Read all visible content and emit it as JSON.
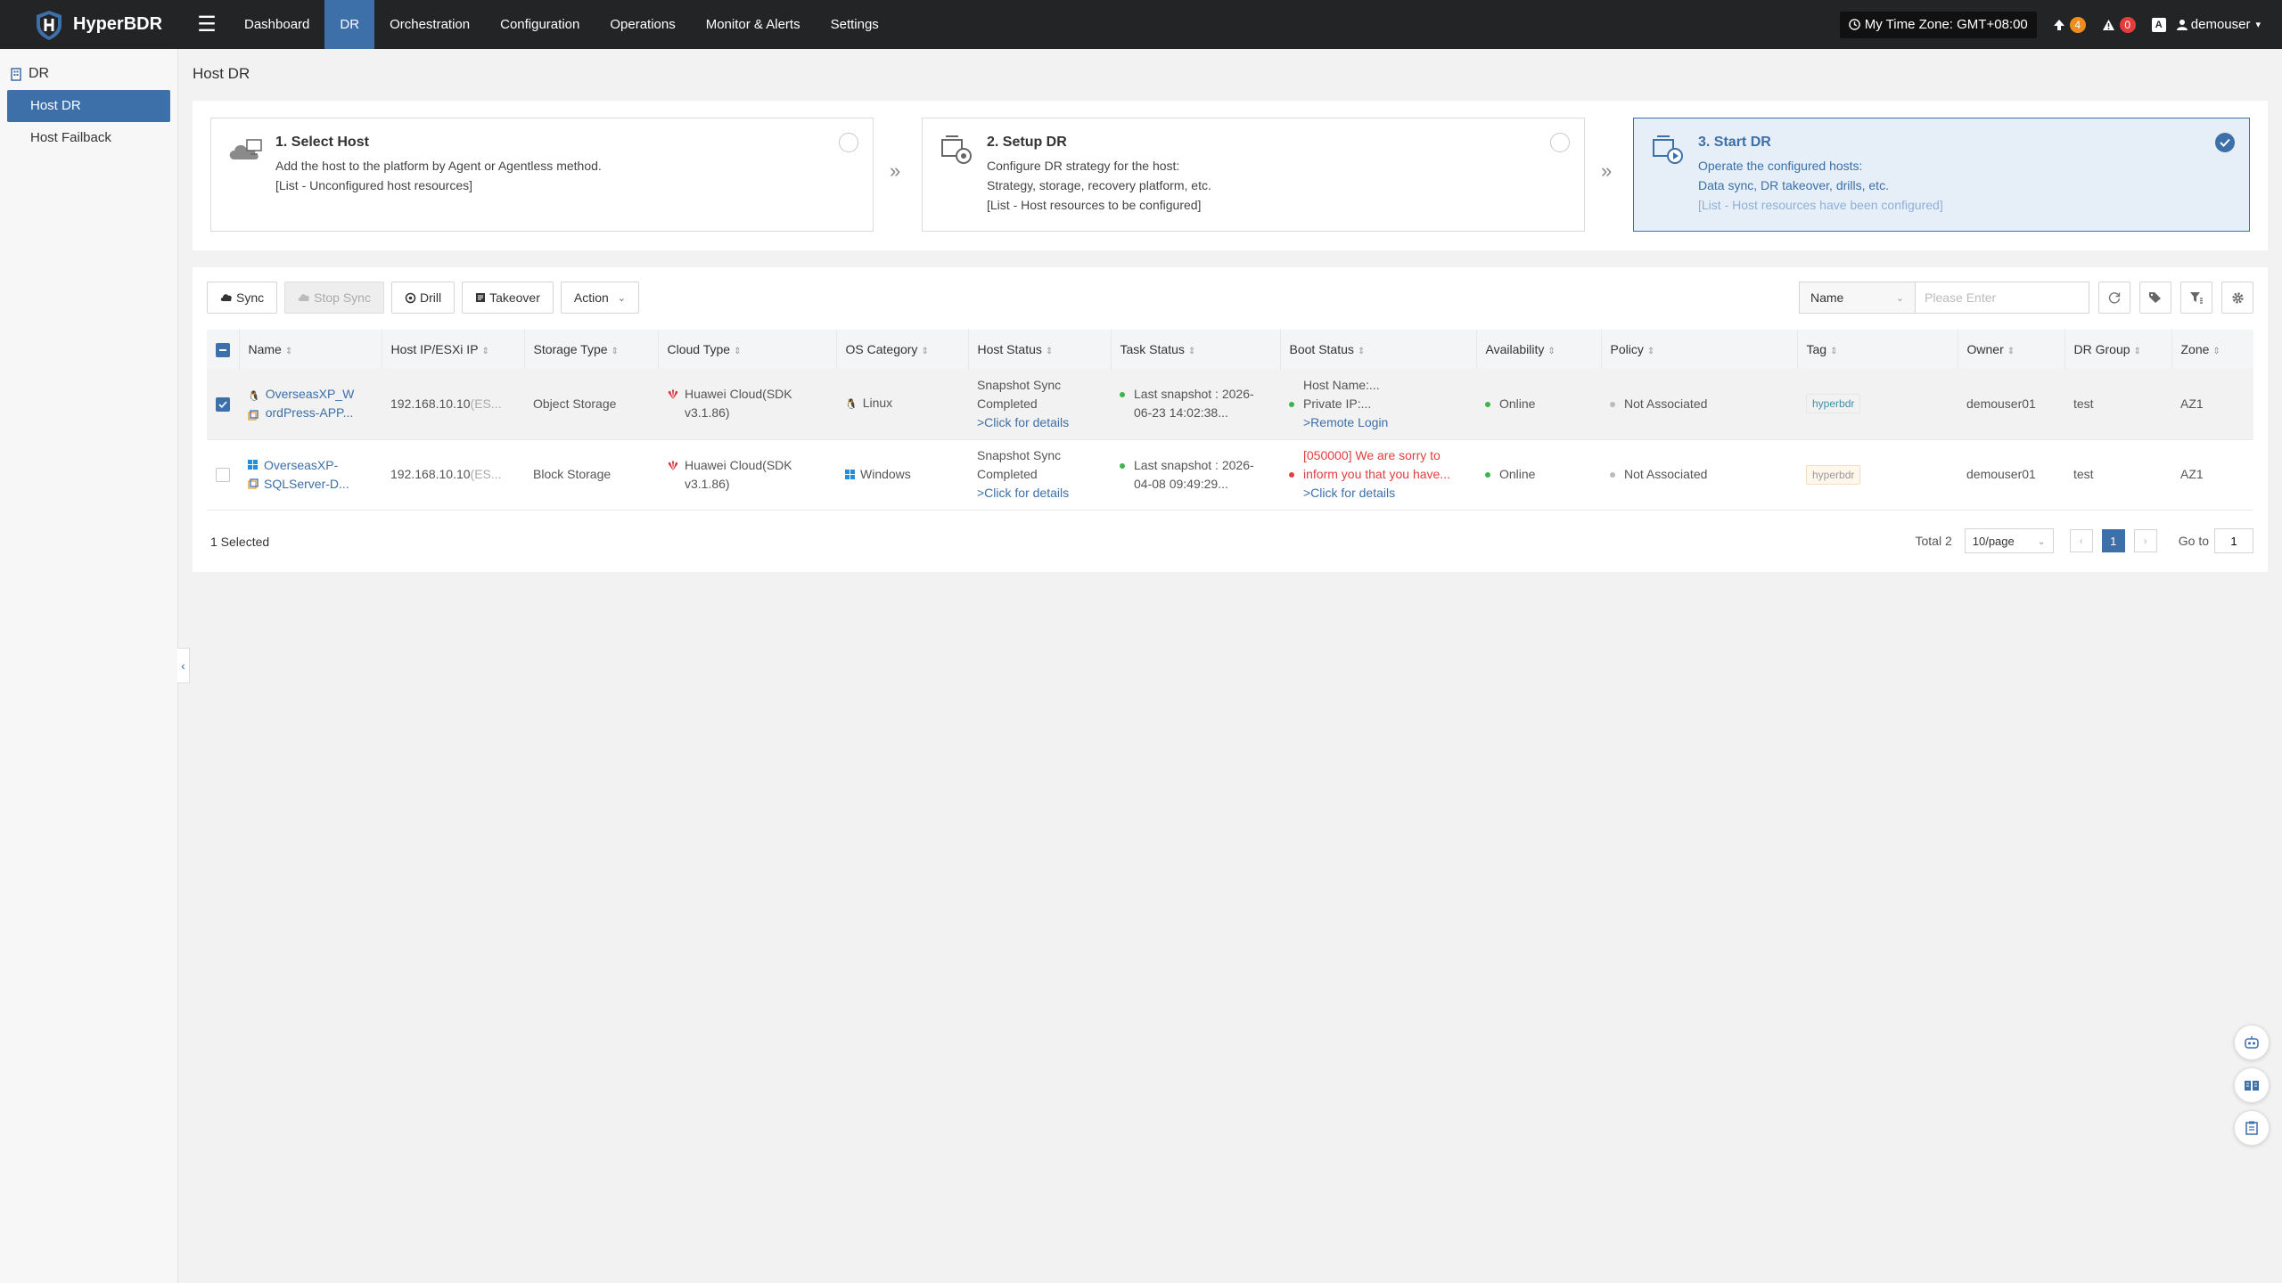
{
  "brand": {
    "name": "HyperBDR"
  },
  "nav": [
    {
      "label": "Dashboard",
      "active": false
    },
    {
      "label": "DR",
      "active": true
    },
    {
      "label": "Orchestration",
      "active": false
    },
    {
      "label": "Configuration",
      "active": false
    },
    {
      "label": "Operations",
      "active": false
    },
    {
      "label": "Monitor & Alerts",
      "active": false
    },
    {
      "label": "Settings",
      "active": false
    }
  ],
  "header_right": {
    "timezone": "My Time Zone: GMT+08:00",
    "upload_count": "4",
    "alert_count": "0",
    "user": "demouser"
  },
  "sidebar": {
    "group": "DR",
    "items": [
      {
        "label": "Host DR",
        "active": true
      },
      {
        "label": "Host Failback",
        "active": false
      }
    ]
  },
  "page_title": "Host DR",
  "steps": [
    {
      "title": "1. Select Host",
      "lines": [
        "Add the host to the platform by Agent or Agentless method.",
        "[List - Unconfigured host resources]"
      ]
    },
    {
      "title": "2. Setup DR",
      "lines": [
        "Configure DR strategy for the host:",
        "Strategy, storage, recovery platform, etc.",
        "[List - Host resources to be configured]"
      ]
    },
    {
      "title": "3. Start DR",
      "lines": [
        "Operate the configured hosts:",
        "Data sync, DR takeover, drills, etc.",
        "[List - Host resources have been configured]"
      ]
    }
  ],
  "toolbar": {
    "sync": "Sync",
    "stop_sync": "Stop Sync",
    "drill": "Drill",
    "takeover": "Takeover",
    "action": "Action"
  },
  "search": {
    "field": "Name",
    "placeholder": "Please Enter"
  },
  "columns": [
    "Name",
    "Host IP/ESXi IP",
    "Storage Type",
    "Cloud Type",
    "OS Category",
    "Host Status",
    "Task Status",
    "Boot Status",
    "Availability",
    "Policy",
    "Tag",
    "Owner",
    "DR Group",
    "Zone"
  ],
  "rows": [
    {
      "selected": true,
      "name1": "OverseasXP_W",
      "name2": "ordPress-APP...",
      "ip": "192.168.10.10",
      "ip_suffix": "(ES...",
      "storage": "Object Storage",
      "cloud1": "Huawei Cloud(SDK",
      "cloud2": "v3.1.86)",
      "os": "Linux",
      "host_status1": "Snapshot Sync",
      "host_status2": "Completed",
      "host_status_link": ">Click for details",
      "task1": "Last snapshot : 2026-",
      "task2": "06-23 14:02:38...",
      "boot1": "Host Name:...",
      "boot2": "Private IP:...",
      "boot_link": ">Remote Login",
      "availability": "Online",
      "policy": "Not Associated",
      "tag": "hyperbdr",
      "owner": "demouser01",
      "group": "test",
      "zone": "AZ1"
    },
    {
      "selected": false,
      "name1": "OverseasXP-",
      "name2": "SQLServer-D...",
      "ip": "192.168.10.10",
      "ip_suffix": "(ES...",
      "storage": "Block Storage",
      "cloud1": "Huawei Cloud(SDK",
      "cloud2": "v3.1.86)",
      "os": "Windows",
      "host_status1": "Snapshot Sync",
      "host_status2": "Completed",
      "host_status_link": ">Click for details",
      "task1": "Last snapshot : 2026-",
      "task2": "04-08 09:49:29...",
      "boot1": "[050000] We are sorry to",
      "boot2": "inform you that you have...",
      "boot_link": ">Click for details",
      "availability": "Online",
      "policy": "Not Associated",
      "tag": "hyperbdr",
      "owner": "demouser01",
      "group": "test",
      "zone": "AZ1"
    }
  ],
  "footer": {
    "selected": "1 Selected",
    "total": "Total 2",
    "page_size": "10/page",
    "current_page": "1",
    "goto_label": "Go to",
    "goto_value": "1"
  },
  "colors": {
    "accent": "#3d6fa8",
    "topbar": "#222426",
    "online": "#3bb54a",
    "error": "#e33d3d"
  }
}
